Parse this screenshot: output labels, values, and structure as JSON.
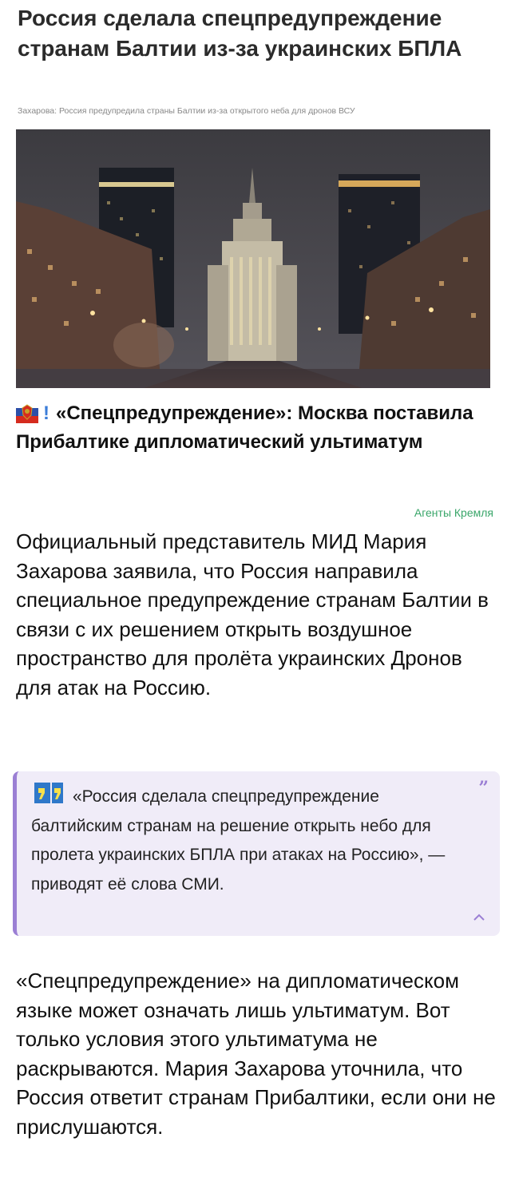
{
  "article": {
    "headline": "Россия сделала спецпредупреждение странам Балтии из-за украинских БПЛА",
    "subline": "Захарова: Россия предупредила страны Балтии из-за открытого неба для дронов ВСУ"
  },
  "post": {
    "title_prefix": "!",
    "title": "«Спецпредупреждение»: Москва поставила Прибалтике дипломатический ультиматум",
    "channel": "Агенты Кремля",
    "paragraph_1": "Официальный представитель МИД Мария Захарова заявила, что Россия направила специальное предупреждение странам Балтии в связи с их решением открыть воздушное пространство для пролёта украинских Дронов для атак на Россию.",
    "quote": "«Россия сделала спецпредупреждение балтийским странам на решение открыть небо для пролета украинских БПЛА при атаках на Россию», — приводят её слова СМИ.",
    "close_quote_mark": "”",
    "paragraph_2": "«Спецпредупреждение» на дипломатическом языке может означать лишь ультиматум. Вот только условия этого ультиматума не раскрываются. Мария Захарова уточнила, что Россия ответит странам Прибалтики, если они не прислушаются."
  },
  "icons": {
    "emblem": "russian-coat-of-arms-icon",
    "quote": "quote-icon",
    "collapse": "chevron-up-icon"
  },
  "colors": {
    "accent_purple": "#9b7fd4",
    "quote_bg": "#f0ecf8",
    "channel_green": "#3aa66a",
    "exclamation_blue": "#3b7dd8"
  }
}
